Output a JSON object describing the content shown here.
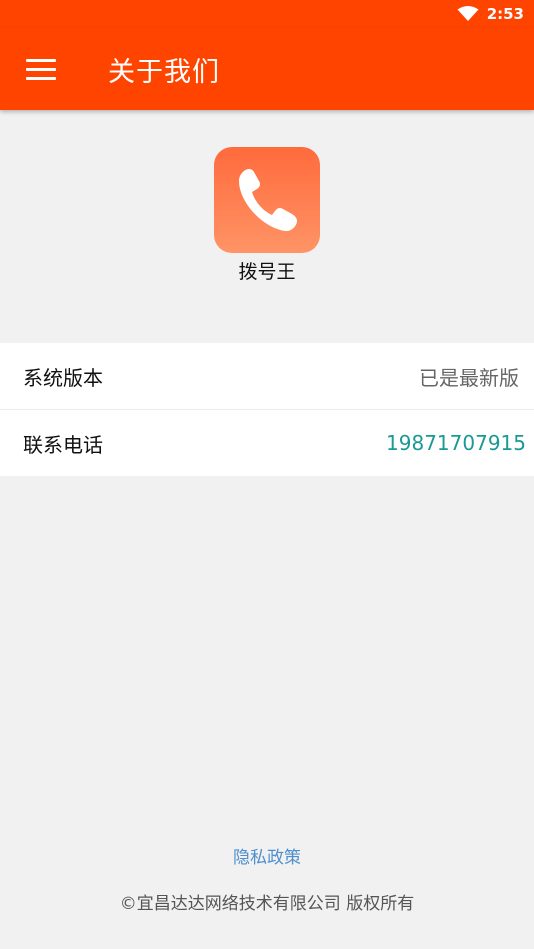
{
  "status_bar": {
    "time": "2:53",
    "icons": [
      "wifi-icon"
    ]
  },
  "app_bar": {
    "title": "关于我们",
    "menu_icon": "hamburger-menu-icon",
    "color": "#ff4400"
  },
  "app_info": {
    "logo_icon": "phone-icon",
    "name": "拨号王"
  },
  "info_rows": [
    {
      "label": "系统版本",
      "value": "已是最新版"
    },
    {
      "label": "联系电话",
      "value": "19871707915"
    }
  ],
  "footer": {
    "privacy_link": "隐私政策",
    "copyright": "©宜昌达达网络技术有限公司 版权所有"
  },
  "colors": {
    "accent": "#ff4400",
    "phone_value": "#1a9a94",
    "link": "#4f8fd0",
    "background": "#f1f1f1"
  }
}
